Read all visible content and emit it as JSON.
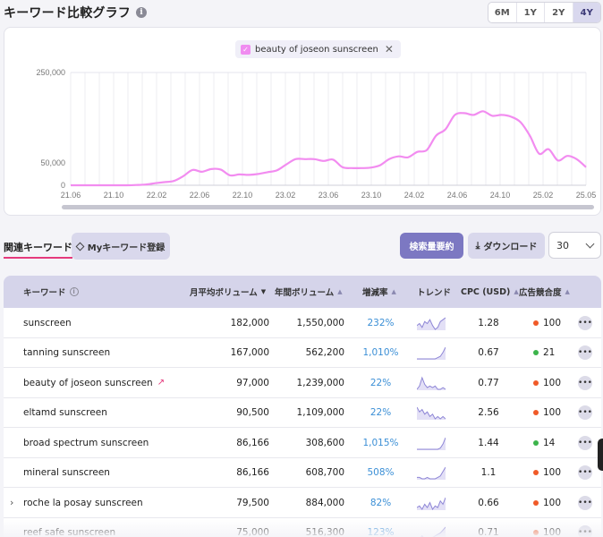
{
  "header": {
    "title": "キーワード比較グラフ",
    "info_icon": "i",
    "ranges": [
      "6M",
      "1Y",
      "2Y",
      "4Y"
    ],
    "active_range": "4Y"
  },
  "legend": {
    "label": "beauty of joseon sunscreen",
    "check": "✓",
    "close": "✕"
  },
  "chart_data": {
    "type": "line",
    "x_tick_labels": [
      "21.06",
      "21.10",
      "22.02",
      "22.06",
      "22.10",
      "23.02",
      "23.06",
      "23.10",
      "24.02",
      "24.06",
      "24.10",
      "25.02",
      "25.05"
    ],
    "y_tick_labels": [
      "250,000",
      "50,000",
      "0"
    ],
    "ylim": [
      0,
      250000
    ],
    "grid": true,
    "line_color": "#f28cf0",
    "series": [
      {
        "values": [
          0,
          0,
          0,
          0,
          0,
          0,
          0,
          500,
          1500,
          4500,
          7000,
          9500,
          20000,
          34000,
          30000,
          36000,
          35000,
          22000,
          24000,
          23000,
          25000,
          29000,
          33000,
          46000,
          58000,
          58000,
          58000,
          54000,
          57000,
          40000,
          38000,
          38000,
          39000,
          44000,
          58000,
          64000,
          62000,
          74000,
          78000,
          110000,
          124000,
          156000,
          160000,
          156000,
          164000,
          154000,
          156000,
          152000,
          140000,
          110000,
          70000,
          80000,
          55000,
          65000,
          58000,
          40000
        ]
      }
    ]
  },
  "toolbar": {
    "related_tab": "関連キーワード",
    "my_keyword_button": "Myキーワード登録",
    "summary_button": "検索量要約",
    "download_button": "ダウンロード",
    "download_icon": "⤓",
    "page_size": "30"
  },
  "table": {
    "columns": {
      "keyword": "キーワード",
      "monthly": "月平均ボリューム",
      "yearly": "年間ボリューム",
      "growth": "増減率",
      "trend": "トレンド",
      "cpc": "CPC (USD)",
      "competition": "広告競合度"
    },
    "rows": [
      {
        "keyword": "sunscreen",
        "monthly": "182,000",
        "yearly": "1,550,000",
        "growth": "232%",
        "cpc": "1.28",
        "comp": "100",
        "comp_color": "#f05a28",
        "trend": [
          6,
          7,
          5,
          8,
          7,
          9,
          6,
          4,
          5,
          8,
          9,
          10
        ],
        "expand": "",
        "trend_mark": ""
      },
      {
        "keyword": "tanning sunscreen",
        "monthly": "167,000",
        "yearly": "562,200",
        "growth": "1,010%",
        "cpc": "0.67",
        "comp": "21",
        "comp_color": "#3cb44b",
        "trend": [
          1,
          1,
          1,
          1,
          1,
          1,
          1,
          1,
          2,
          3,
          6,
          10
        ],
        "expand": "",
        "trend_mark": ""
      },
      {
        "keyword": "beauty of joseon sunscreen",
        "monthly": "97,000",
        "yearly": "1,239,000",
        "growth": "22%",
        "cpc": "0.77",
        "comp": "100",
        "comp_color": "#f05a28",
        "trend": [
          3,
          5,
          10,
          6,
          4,
          5,
          4,
          5,
          3,
          3,
          4,
          3
        ],
        "expand": "",
        "trend_mark": "↗"
      },
      {
        "keyword": "eltamd sunscreen",
        "monthly": "90,500",
        "yearly": "1,109,000",
        "growth": "22%",
        "cpc": "2.56",
        "comp": "100",
        "comp_color": "#f05a28",
        "trend": [
          8,
          6,
          7,
          5,
          6,
          4,
          5,
          3,
          4,
          3,
          4,
          3
        ],
        "expand": "",
        "trend_mark": ""
      },
      {
        "keyword": "broad spectrum sunscreen",
        "monthly": "86,166",
        "yearly": "308,600",
        "growth": "1,015%",
        "cpc": "1.44",
        "comp": "14",
        "comp_color": "#3cb44b",
        "trend": [
          1,
          1,
          1,
          1,
          1,
          1,
          1,
          1,
          1,
          2,
          5,
          10
        ],
        "expand": "",
        "trend_mark": ""
      },
      {
        "keyword": "mineral sunscreen",
        "monthly": "86,166",
        "yearly": "608,700",
        "growth": "508%",
        "cpc": "1.1",
        "comp": "100",
        "comp_color": "#f05a28",
        "trend": [
          3,
          3,
          2,
          2,
          3,
          2,
          2,
          2,
          3,
          4,
          7,
          10
        ],
        "expand": "",
        "trend_mark": ""
      },
      {
        "keyword": "roche la posay sunscreen",
        "monthly": "79,500",
        "yearly": "884,000",
        "growth": "82%",
        "cpc": "0.66",
        "comp": "100",
        "comp_color": "#f05a28",
        "trend": [
          3,
          4,
          2,
          5,
          3,
          6,
          2,
          4,
          3,
          7,
          5,
          9
        ],
        "expand": "›",
        "trend_mark": ""
      },
      {
        "keyword": "reef safe sunscreen",
        "monthly": "75,000",
        "yearly": "516,300",
        "growth": "123%",
        "cpc": "0.71",
        "comp": "100",
        "comp_color": "#f05a28",
        "trend": [
          3,
          2,
          4,
          2,
          3,
          2,
          3,
          4,
          5,
          6,
          8,
          10
        ],
        "expand": "",
        "trend_mark": ""
      }
    ],
    "more_icon": "•••"
  }
}
